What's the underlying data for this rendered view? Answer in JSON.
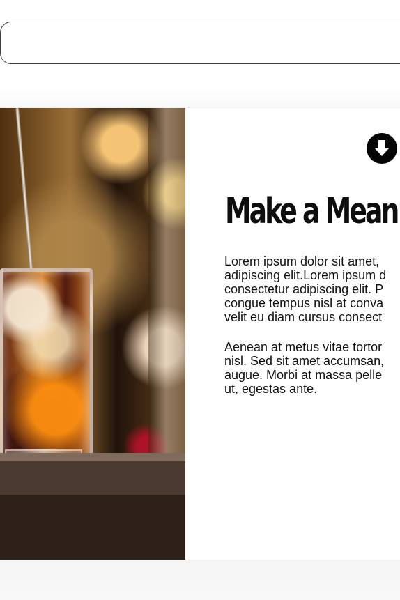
{
  "top_input": {
    "value": "",
    "placeholder": ""
  },
  "article": {
    "title": "Make a Mean Co",
    "paragraphs": [
      {
        "lines": [
          "Lorem ipsum dolor sit amet,",
          "adipiscing elit.Lorem ipsum d",
          "consectetur adipiscing elit. P",
          "congue tempus nisl at conva",
          "velit eu diam cursus consect"
        ]
      },
      {
        "lines": [
          "Aenean at metus vitae tortor",
          "nisl. Sed sit amet accumsan,",
          "augue. Morbi at massa pelle",
          "ut, egestas ante."
        ]
      }
    ]
  },
  "icons": {
    "download": "download-arrow-circle-icon"
  },
  "colors": {
    "text": "#111111",
    "icon": "#050505",
    "border": "#3c3c3c"
  }
}
